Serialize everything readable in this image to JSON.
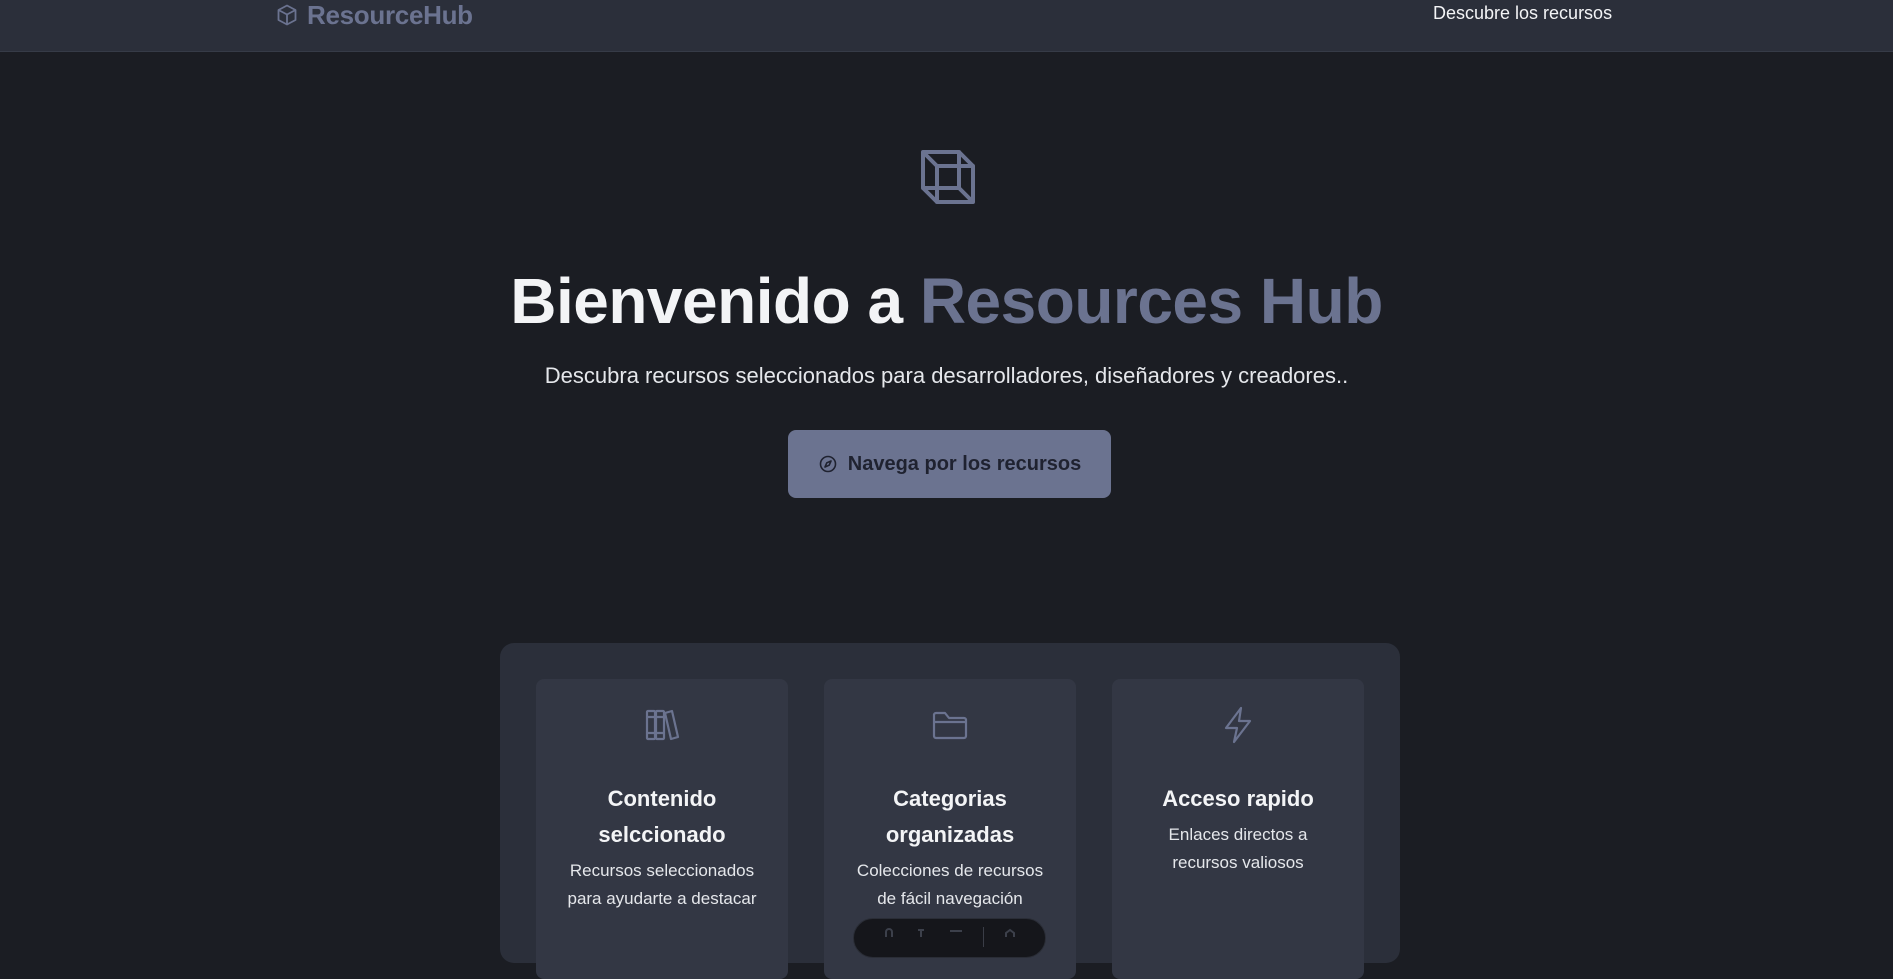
{
  "header": {
    "brand": "ResourceHub",
    "brand_icon": "cube-icon",
    "nav_link": "Descubre los recursos"
  },
  "hero": {
    "icon": "cube-outline-icon",
    "title_prefix": "Bienvenido a ",
    "title_accent": "Resources Hub",
    "subtitle": "Descubra recursos seleccionados para desarrolladores, diseñadores y creadores..",
    "cta_label": "Navega por los recursos",
    "cta_icon": "compass-icon"
  },
  "features": [
    {
      "icon": "books-icon",
      "title_line1": "Contenido",
      "title_line2": "selccionado",
      "desc_line1": "Recursos seleccionados",
      "desc_line2": "para ayudarte a destacar"
    },
    {
      "icon": "folder-icon",
      "title_line1": "Categorias",
      "title_line2": "organizadas",
      "desc_line1": "Colecciones de recursos",
      "desc_line2": "de fácil navegación"
    },
    {
      "icon": "lightning-icon",
      "title_line1": "Acceso rapido",
      "desc_line1": "Enlaces directos a",
      "desc_line2": "recursos valiosos"
    }
  ],
  "colors": {
    "background": "#1b1d23",
    "header": "#2b2f3a",
    "accent": "#6b7390",
    "card": "#333744",
    "text": "#f3f4f6"
  }
}
